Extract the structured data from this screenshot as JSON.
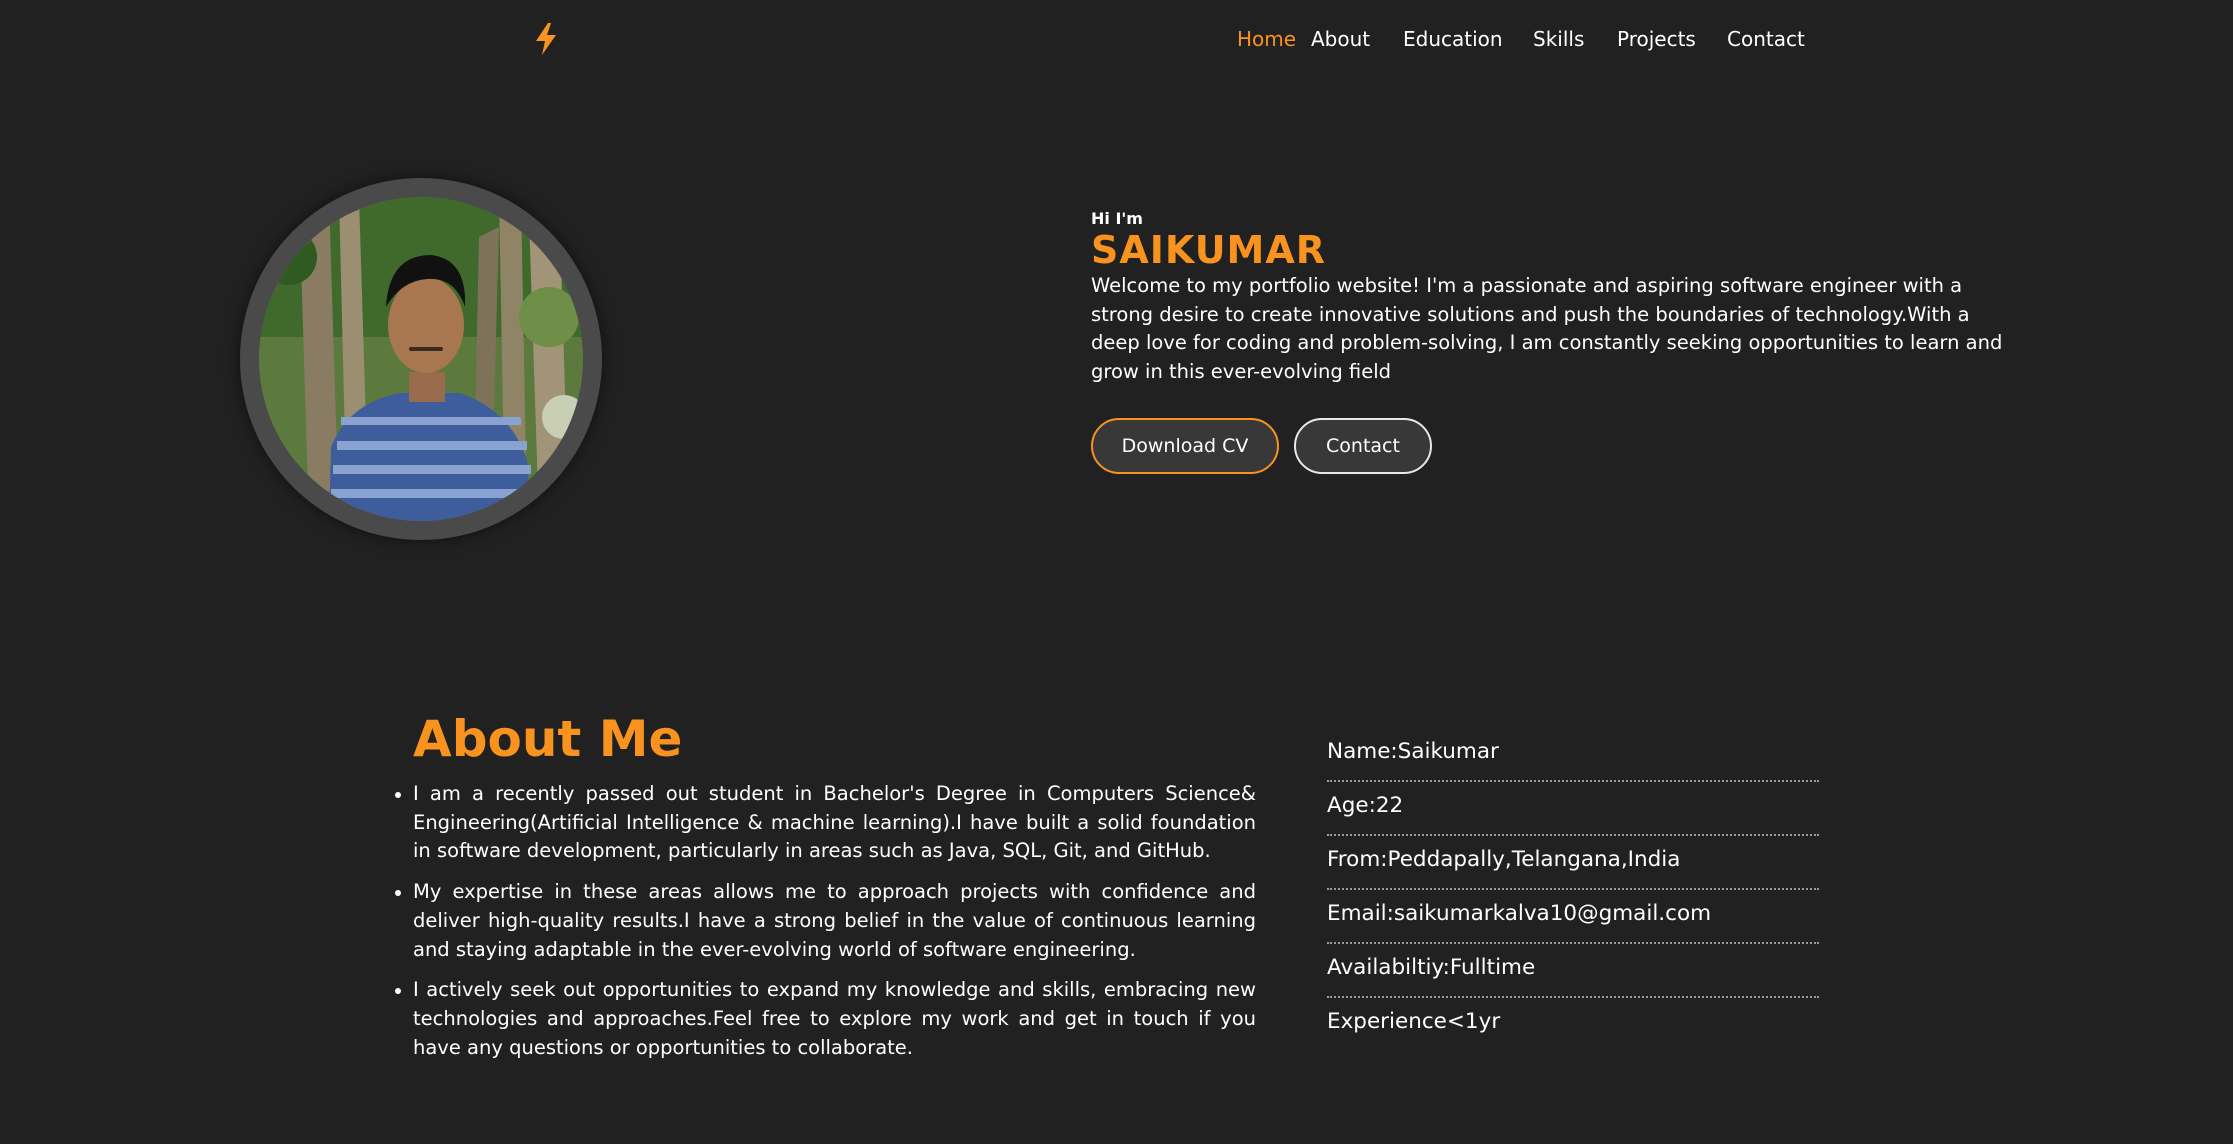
{
  "nav": {
    "logo_icon": "lightning-bolt-icon",
    "items": [
      {
        "label": "Home",
        "active": true
      },
      {
        "label": "About"
      },
      {
        "label": "Education"
      },
      {
        "label": "Skills"
      },
      {
        "label": "Projects"
      },
      {
        "label": "Contact"
      }
    ]
  },
  "hero": {
    "greeting": "Hi I'm",
    "name": "SAIKUMAR",
    "description": "Welcome to my portfolio website! I'm a passionate and aspiring software engineer with a strong desire to create innovative solutions and push the boundaries of technology.With a deep love for coding and problem-solving, I am constantly seeking opportunities to learn and grow in this ever-evolving field",
    "buttons": {
      "download_cv": "Download CV",
      "contact": "Contact"
    }
  },
  "about": {
    "title": "About Me",
    "points": [
      "I am a recently passed out student in Bachelor's Degree in Computers Science& Engineering(Artificial Intelligence & machine learning).I have built a solid foundation in software development, particularly in areas such as Java, SQL, Git, and GitHub.",
      "My expertise in these areas allows me to approach projects with confidence and deliver high-quality results.I have a strong belief in the value of continuous learning and staying adaptable in the ever-evolving world of software engineering.",
      "I actively seek out opportunities to expand my knowledge and skills, embracing new technologies and approaches.Feel free to explore my work and get in touch if you have any questions or opportunities to collaborate."
    ],
    "info": [
      "Name:Saikumar",
      "Age:22",
      "From:Peddapally,Telangana,India",
      "Email:saikumarkalva10@gmail.com",
      "Availabiltiy:Fulltime",
      "Experience<1yr"
    ]
  },
  "colors": {
    "background": "#212121",
    "accent": "#f7931e",
    "text": "#ffffff",
    "button_bg": "#383838"
  }
}
